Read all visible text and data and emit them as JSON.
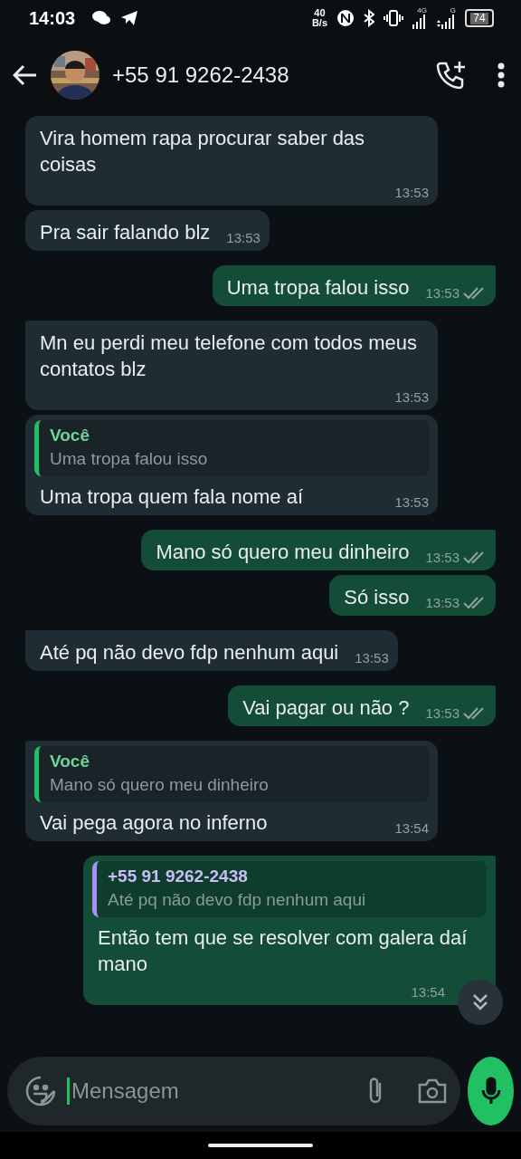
{
  "status_bar": {
    "time": "14:03",
    "speed_value": "40",
    "speed_unit": "B/s",
    "network_1": "4G",
    "network_2": "G",
    "battery": "74"
  },
  "header": {
    "contact": "+55 91 9262-2438"
  },
  "messages": [
    {
      "kind": "incoming",
      "tail": false,
      "text": "Vira homem rapa procurar saber das coisas",
      "time": "13:53"
    },
    {
      "kind": "incoming",
      "tail": false,
      "text": "Pra sair falando blz",
      "time": "13:53"
    },
    {
      "kind": "outgoing",
      "tail": true,
      "text": "Uma tropa falou isso",
      "time": "13:53",
      "read": false
    },
    {
      "kind": "incoming",
      "tail": true,
      "text": "Mn eu perdi meu telefone com todos meus contatos blz",
      "time": "13:53"
    },
    {
      "kind": "incoming",
      "tail": false,
      "text": "Uma tropa quem fala nome aí",
      "time": "13:53",
      "quote": {
        "author": "Você",
        "text": "Uma tropa falou isso",
        "mine": true
      }
    },
    {
      "kind": "outgoing",
      "tail": true,
      "text": "Mano só quero meu dinheiro",
      "time": "13:53",
      "read": false
    },
    {
      "kind": "outgoing",
      "tail": false,
      "text": "Só isso",
      "time": "13:53",
      "read": false
    },
    {
      "kind": "incoming",
      "tail": true,
      "text": "Até pq não devo fdp nenhum aqui",
      "time": "13:53"
    },
    {
      "kind": "outgoing",
      "tail": true,
      "text": "Vai pagar ou não ?",
      "time": "13:53",
      "read": false
    },
    {
      "kind": "incoming",
      "tail": true,
      "text": "Vai pega agora no inferno",
      "time": "13:54",
      "quote": {
        "author": "Você",
        "text": "Mano só quero meu dinheiro",
        "mine": true
      }
    },
    {
      "kind": "outgoing",
      "tail": true,
      "text": "Então tem que se resolver com galera daí mano",
      "time": "13:54",
      "quote": {
        "author": "+55 91 9262-2438",
        "text": "Até pq não devo fdp nenhum aqui",
        "mine": false
      }
    }
  ],
  "composer": {
    "placeholder": "Mensagem"
  }
}
